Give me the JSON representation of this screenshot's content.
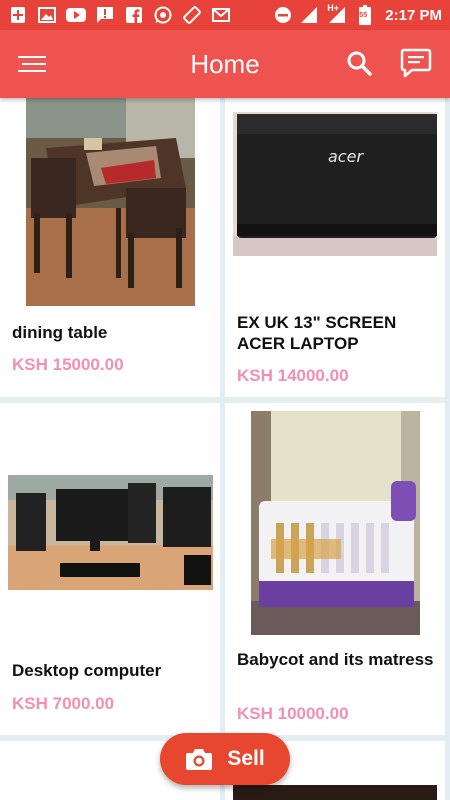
{
  "status_bar": {
    "time": "2:17 PM",
    "network": "H+",
    "battery": "55",
    "notification_icons": [
      "add-icon",
      "image-icon",
      "youtube-icon",
      "message-alert-icon",
      "facebook-icon",
      "whatsapp-icon",
      "screen-rotate-icon",
      "mail-icon"
    ]
  },
  "app_bar": {
    "title": "Home",
    "menu_icon": "menu-icon",
    "search_icon": "search-icon",
    "chat_icon": "chat-icon"
  },
  "listings": [
    {
      "title": "dining table",
      "price": "KSH 15000.00",
      "image": "dining-table-photo"
    },
    {
      "title": "EX UK 13\" SCREEN ACER LAPTOP",
      "price": "KSH 14000.00",
      "image": "acer-laptop-photo"
    },
    {
      "title": "Desktop computer",
      "price": "KSH 7000.00",
      "image": "desktop-computer-photo"
    },
    {
      "title": "Babycot and its matress",
      "price": "KSH 10000.00",
      "image": "babycot-photo"
    }
  ],
  "sell_button": {
    "label": "Sell",
    "icon": "camera-icon"
  },
  "colors": {
    "status_bar": "#e8433b",
    "app_bar": "#ef5350",
    "price": "#f48fb1",
    "sell_button": "#e8472f",
    "background": "#e3eef2"
  }
}
